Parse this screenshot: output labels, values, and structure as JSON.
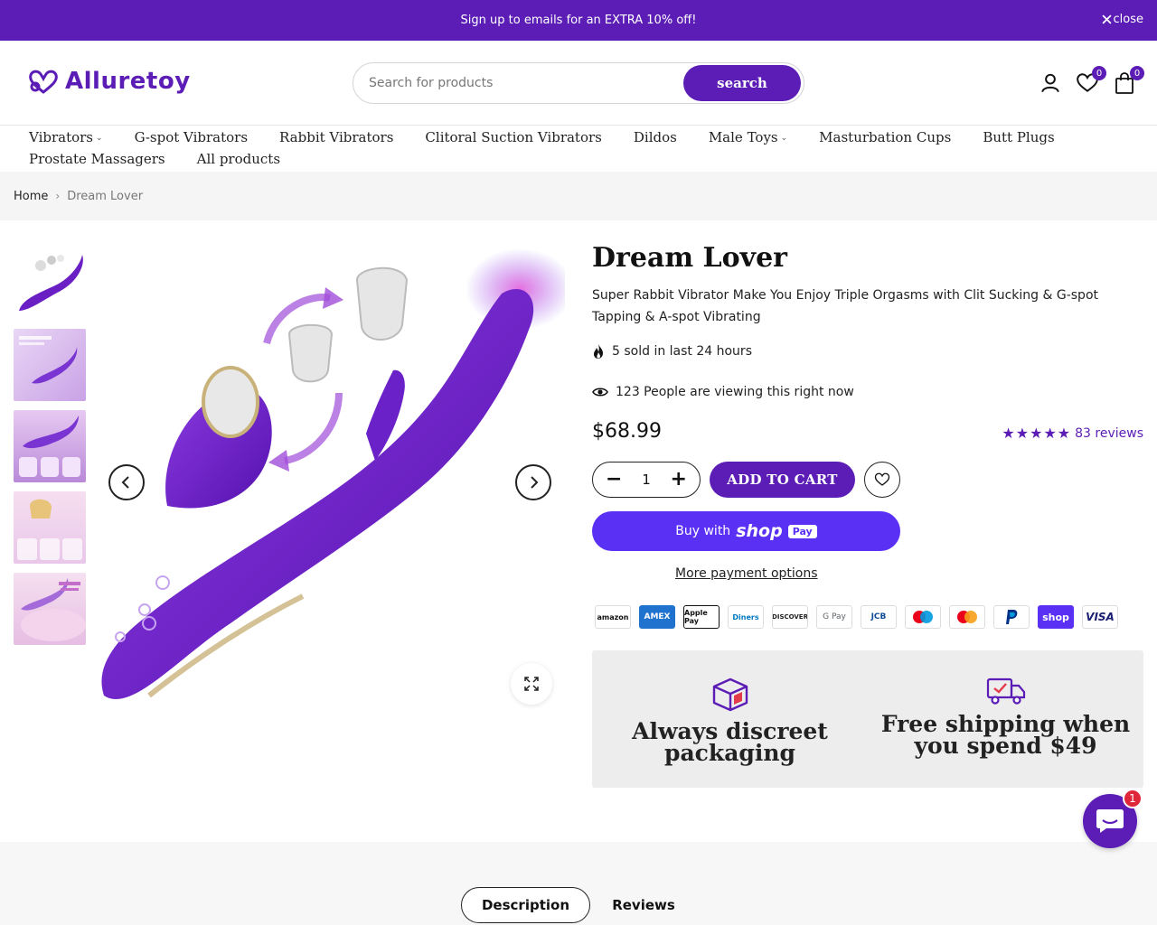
{
  "announcement": {
    "text": "Sign up to emails for an EXTRA 10% off!",
    "close_label": "close"
  },
  "header": {
    "logo_text": "Alluretoy",
    "search_placeholder": "Search for products",
    "search_button": "search",
    "wishlist_count": "0",
    "cart_count": "0"
  },
  "nav": {
    "row1": [
      "Vibrators",
      "G-spot Vibrators",
      "Rabbit Vibrators",
      "Clitoral Suction Vibrators",
      "Dildos",
      "Male Toys",
      "Masturbation Cups",
      "Butt Plugs"
    ],
    "row2": [
      "Prostate Massagers",
      "All products"
    ]
  },
  "breadcrumb": {
    "home": "Home",
    "current": "Dream Lover"
  },
  "product": {
    "title": "Dream Lover",
    "subtitle": "Super Rabbit Vibrator Make You Enjoy Triple Orgasms with Clit Sucking & G-spot Tapping & A-spot Vibrating",
    "sold_text": "5 sold in last 24 hours",
    "viewing_text": "123 People are viewing this right now",
    "price": "$68.99",
    "stars": "★★★★★",
    "rating_value": 5,
    "reviews_text": "83 reviews",
    "quantity": "1",
    "add_to_cart": "ADD TO CART",
    "buy_with": "Buy with",
    "shop_brand": "shop",
    "pay_label": "Pay",
    "more_payment": "More payment options"
  },
  "payment_methods": [
    "amazon",
    "AMEX",
    "Apple Pay",
    "Diners",
    "DISCOVER",
    "G Pay",
    "JCB",
    "Maestro",
    "Mastercard",
    "PayPal",
    "shop",
    "VISA"
  ],
  "features": [
    {
      "icon": "package-box-icon",
      "title": "Always discreet packaging"
    },
    {
      "icon": "delivery-truck-icon",
      "title": "Free shipping when you spend $49"
    }
  ],
  "tabs": {
    "description": "Description",
    "reviews": "Reviews"
  },
  "chat": {
    "unread": "1"
  },
  "colors": {
    "brand": "#5b1db5",
    "shop_pay": "#5a31f4"
  }
}
